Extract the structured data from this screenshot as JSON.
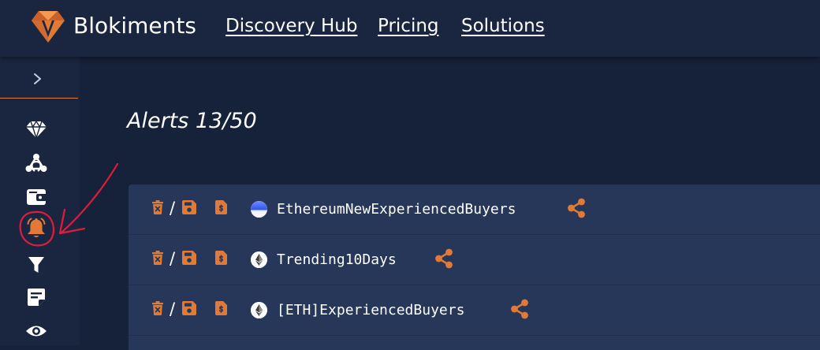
{
  "header": {
    "brand": "Blokiments",
    "nav": [
      "Discovery Hub",
      "Pricing",
      "Solutions"
    ]
  },
  "sidebar": {
    "toggle_icon": "chevron-right-icon",
    "items": [
      {
        "icon": "diamond-icon"
      },
      {
        "icon": "network-icon"
      },
      {
        "icon": "wallet-icon"
      },
      {
        "icon": "bell-icon",
        "active": true
      },
      {
        "icon": "filter-icon"
      },
      {
        "icon": "note-icon"
      },
      {
        "icon": "eye-icon"
      }
    ]
  },
  "main": {
    "title": "Alerts 13/50",
    "alerts": [
      {
        "name": "EthereumNewExperiencedBuyers",
        "token_icon": "blue-sphere-icon"
      },
      {
        "name": "Trending10Days",
        "token_icon": "ethereum-icon"
      },
      {
        "name": "[ETH]ExperiencedBuyers",
        "token_icon": "ethereum-icon"
      }
    ],
    "row_separator": "/"
  },
  "colors": {
    "background": "#16213a",
    "header": "#1a2640",
    "panel": "#27375a",
    "accent": "#e07a34",
    "annotation": "#e01b3c"
  }
}
